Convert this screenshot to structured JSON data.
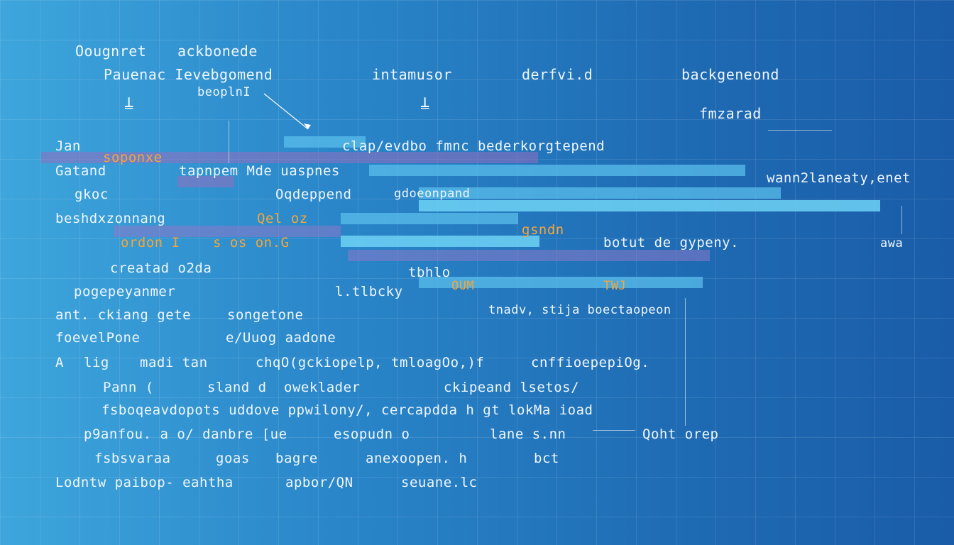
{
  "header": {
    "h1": "Oougnret",
    "h2": "ackbonede",
    "h3": "Pauenac Ievebgomend",
    "h4": "intamusor",
    "h5": "derfvi.d",
    "h6": "backgeneond",
    "h7": "beoplnI",
    "h8": "fmzarad"
  },
  "lines": [
    "Jan",
    "clap/evdbo fmnc bederkorgtepend",
    "soponxe",
    "Gatand",
    "tapnpem Mde uaspnes",
    "wann2laneaty,enet",
    "gkoc",
    "Oqdeppend",
    "gdoeonpand",
    "beshdxzonnang",
    "Qel oz",
    "gsndn",
    "ordon I",
    "s os on.G",
    "botut de gypeny.",
    "awa",
    "creatad o2da",
    "tbhlo",
    "pogepeyanmer",
    "l.tlbcky",
    "ant. ckiang gete",
    "songetone",
    "tnadv, stija boectaopeon",
    "foevelPone",
    "e/Uuog aadone",
    "A",
    "lig",
    "madi tan",
    "chqO(gckiopelp, tmloagOo,)f",
    "cnffioepepiOg.",
    "Pann (",
    "sland d",
    "oweklader",
    "ckipeand lsetos/",
    "fsboqeavdopots uddove ppwilony/, cercapdda h gt lokMa ioad",
    "p9anfou. a o/ danbre [ue",
    "esopudn o",
    "lane s.nn",
    "Qoht orep",
    "fsbsvaraa",
    "goas",
    "bagre",
    "anexoopen. h",
    "bct",
    "Lodntw paibop- eahtha",
    "apbor/QN",
    "seuane.lc",
    "OUM",
    "TWJ"
  ]
}
